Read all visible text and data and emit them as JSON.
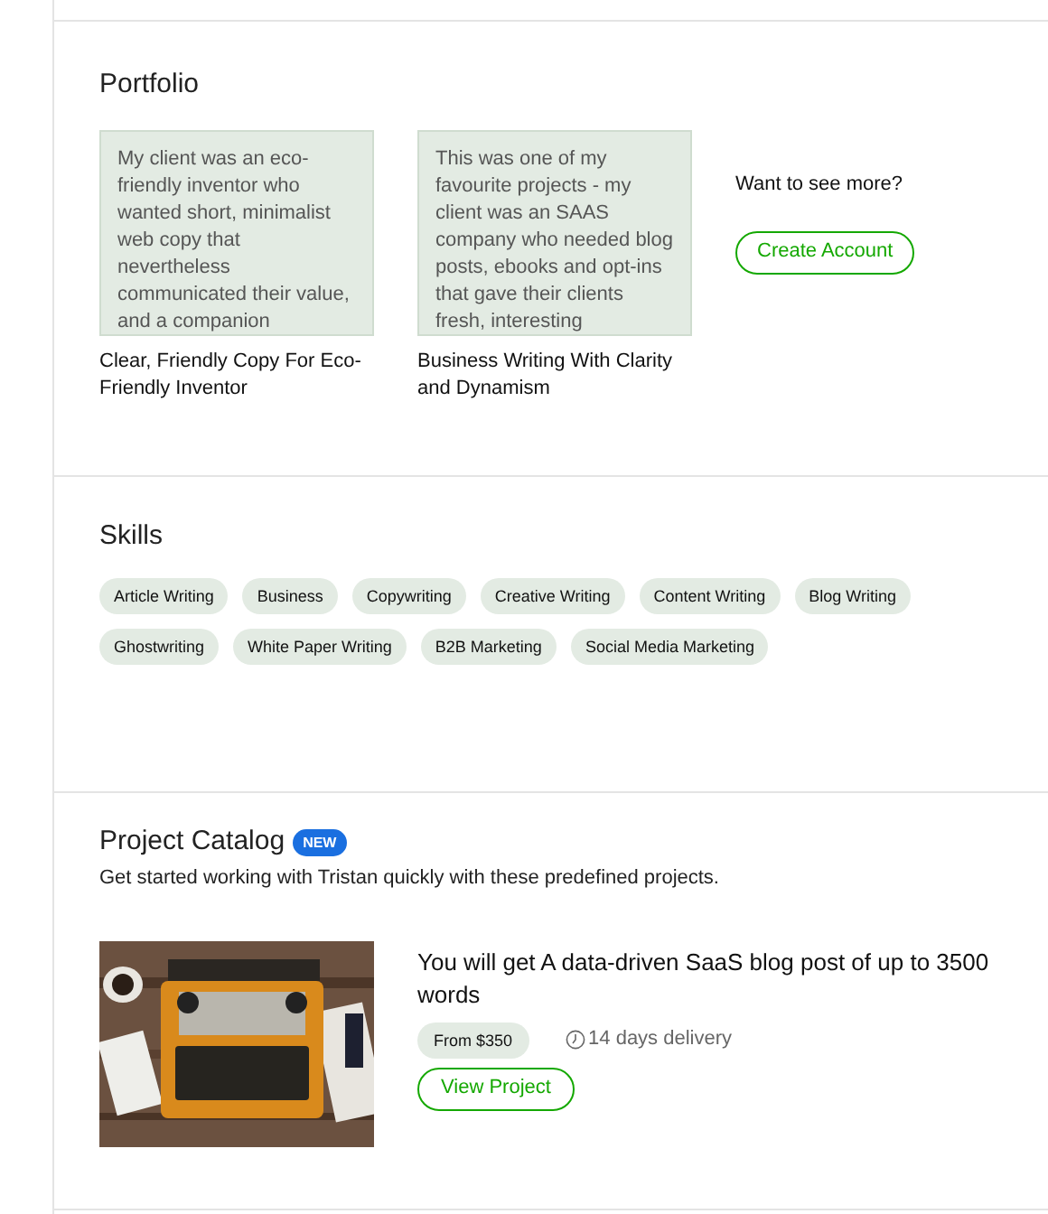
{
  "portfolio": {
    "title": "Portfolio",
    "items": [
      {
        "excerpt": "My client was an eco-friendly inventor who wanted short, minimalist web copy that nevertheless communicated their value, and a companion",
        "title": "Clear, Friendly Copy For Eco-Friendly Inventor"
      },
      {
        "excerpt": "This was one of my favourite projects - my client was an SAAS company who needed blog posts, ebooks and opt-ins that gave their clients fresh, interesting",
        "title": "Business Writing With Clarity and Dynamism"
      }
    ],
    "more_prompt": "Want to see more?",
    "button": "Create Account"
  },
  "skills": {
    "title": "Skills",
    "tags": [
      "Article Writing",
      "Business",
      "Copywriting",
      "Creative Writing",
      "Content Writing",
      "Blog Writing",
      "Ghostwriting",
      "White Paper Writing",
      "B2B Marketing",
      "Social Media Marketing"
    ]
  },
  "project_catalog": {
    "title": "Project Catalog",
    "badge": "NEW",
    "subtitle": "Get started working with Tristan quickly with these predefined projects.",
    "projects": [
      {
        "title": "You will get A data-driven SaaS blog post of up to 3500 words",
        "price": "From $350",
        "delivery": "14 days delivery",
        "button": "View Project"
      }
    ]
  }
}
